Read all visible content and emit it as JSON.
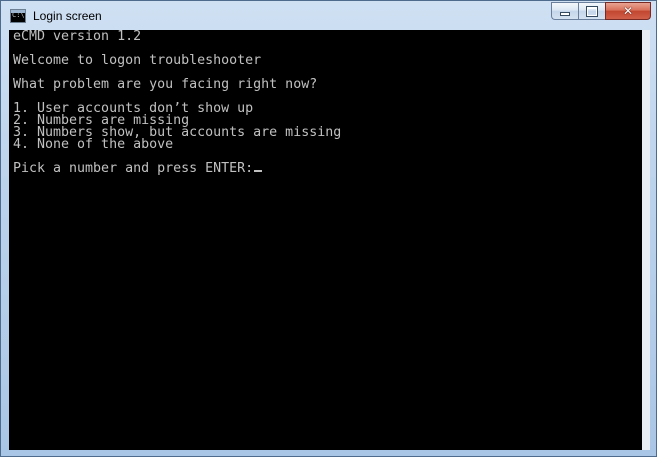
{
  "window": {
    "title": "Login screen",
    "app_icon": "console-icon",
    "app_icon_text": "C:\\"
  },
  "controls": {
    "minimize": "minimize-icon",
    "maximize": "maximize-icon",
    "close": "✕"
  },
  "console": {
    "version": "eCMD version 1.2",
    "welcome": "Welcome to logon troubleshooter",
    "question": "What problem are you facing right now?",
    "options": [
      "1. User accounts don’t show up",
      "2. Numbers are missing",
      "3. Numbers show, but accounts are missing",
      "4. None of the above"
    ],
    "prompt": "Pick a number and press ENTER:",
    "input_value": ""
  },
  "colors": {
    "console_bg": "#000000",
    "console_text": "#c0c0c0",
    "close_button": "#c24630"
  }
}
